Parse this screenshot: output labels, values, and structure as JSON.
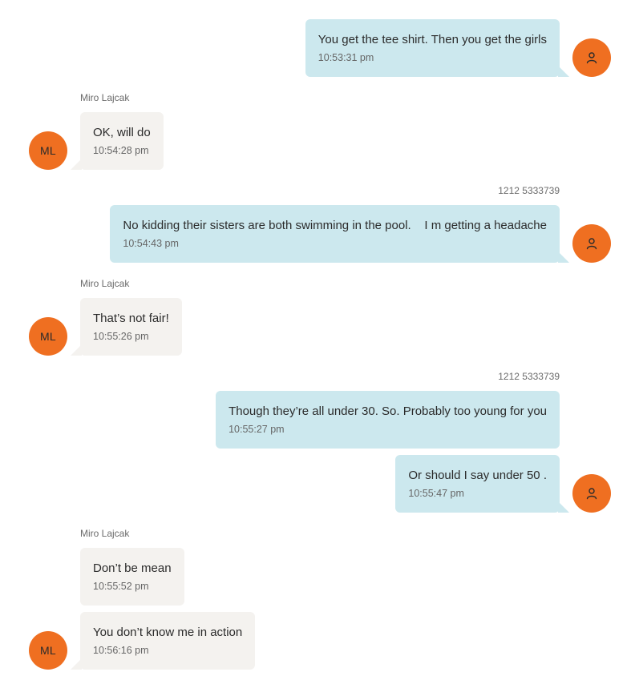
{
  "colors": {
    "outgoing_bubble": "#cce8ee",
    "incoming_bubble": "#f4f2ef",
    "avatar": "#ef6f21"
  },
  "icons": {
    "outgoing_avatar": "person-icon"
  },
  "messages": [
    {
      "direction": "out",
      "sender": "",
      "text": "You get the tee shirt.  Then you get the girls",
      "time": "10:53:31 pm"
    },
    {
      "direction": "in",
      "sender": "Miro Lajcak",
      "avatar_initials": "ML",
      "text": "OK, will do",
      "time": "10:54:28 pm"
    },
    {
      "direction": "out",
      "sender": "1212 5333739",
      "text": "No kidding their sisters are both swimming in the pool.    I m getting a headache",
      "time": "10:54:43 pm"
    },
    {
      "direction": "in",
      "sender": "Miro Lajcak",
      "avatar_initials": "ML",
      "text": "That’s not fair!",
      "time": "10:55:26 pm"
    },
    {
      "direction": "out",
      "sender": "1212 5333739",
      "text": "Though they’re all under 30. So. Probably too young for you",
      "time": "10:55:27 pm"
    },
    {
      "direction": "out",
      "sender": "",
      "text": "Or should I say under 50 .",
      "time": "10:55:47 pm"
    },
    {
      "direction": "in",
      "sender": "Miro Lajcak",
      "avatar_initials": "",
      "text": "Don’t be mean",
      "time": "10:55:52 pm"
    },
    {
      "direction": "in",
      "sender": "",
      "avatar_initials": "ML",
      "text": "You don’t know me in action",
      "time": "10:56:16 pm"
    }
  ]
}
